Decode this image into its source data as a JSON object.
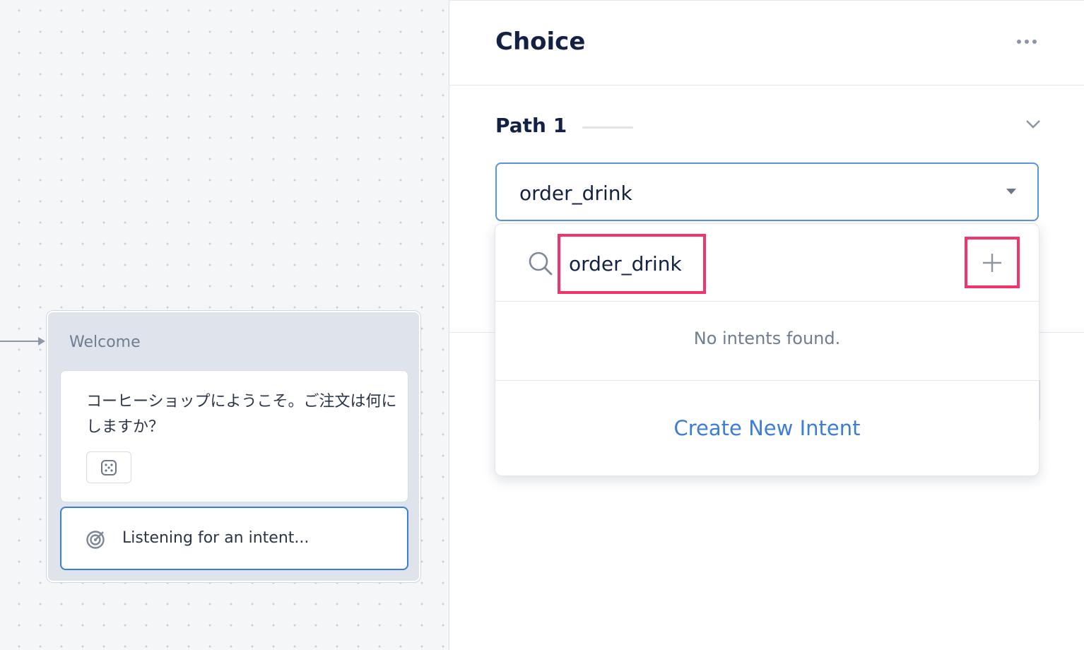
{
  "canvas": {
    "block": {
      "title": "Welcome",
      "speak_text": "コーヒーショップにようこそ。ご注文は何にしますか？",
      "speak_badge_icon": "dice-icon",
      "listen_icon": "target-icon",
      "listen_text": "Listening for an intent..."
    }
  },
  "panel": {
    "title": "Choice",
    "more_icon": "more-horizontal-icon",
    "path": {
      "label": "Path 1",
      "chevron_icon": "chevron-down-icon",
      "selected_intent": "order_drink"
    },
    "dropdown": {
      "search_icon": "search-icon",
      "search_value": "order_drink",
      "add_icon": "plus-icon",
      "empty_text": "No intents found.",
      "create_label": "Create New Intent"
    }
  },
  "colors": {
    "accent": "#3b7dd8",
    "highlight": "#f4336a",
    "title_text": "#132144",
    "muted_text": "#6e7d90",
    "block_bg": "#dfe4ec"
  }
}
